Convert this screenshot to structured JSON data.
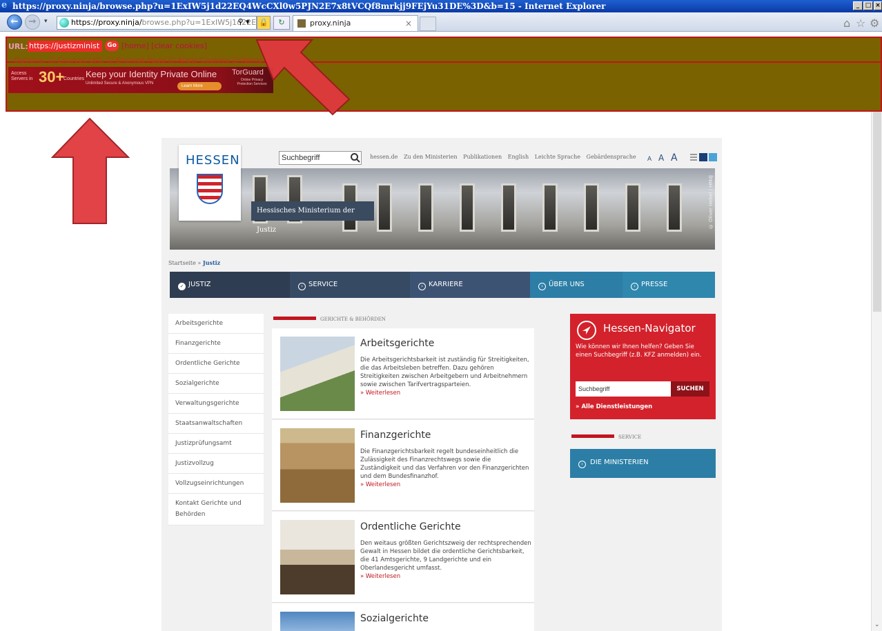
{
  "browser": {
    "title": "https://proxy.ninja/browse.php?u=1ExIW5j1d22EQ4WcCXl0w5PJN2E7x8tVCQf8mrkjj9FEjYu31DE%3D&b=15 - Internet Explorer",
    "address_main": "https://proxy.ninja/",
    "address_dim": "browse.php?u=1ExIW5j1d22EQ4",
    "tab_label": "proxy.ninja",
    "tab_close": "×"
  },
  "proxy": {
    "url_label": "URL:",
    "url_value": "https://justizminist",
    "go_label": "Go",
    "links": "[home] [clear cookies]",
    "options": "Options: ☑ Encrypt URL ☑ Encrypt Page ☑ Allow Cookies ☑ Remove S"
  },
  "ad": {
    "access": "Access Servers in",
    "count": "30+",
    "countries": "Countries",
    "slogan": "Keep your Identity Private Online",
    "sub": "Unlimited Secure & Anonymous VPN",
    "learn": "Learn More",
    "brand": "TorGuard",
    "brand_sub": "Online Privacy Protection Services"
  },
  "site": {
    "logo_text": "HESSEN",
    "search_placeholder": "Suchbegriff",
    "top_links": [
      "hessen.de",
      "Zu den Ministerien",
      "Publikationen",
      "English",
      "Leichte Sprache",
      "Gebärdensprache"
    ],
    "font_sizes": [
      "A",
      "A",
      "A"
    ],
    "banner_credit": "© Oliver Hebel / HMdJ",
    "ministry": "Hessisches Ministerium der Justiz",
    "breadcrumb_home": "Startseite »",
    "breadcrumb_current": "Justiz",
    "nav": [
      {
        "label": "JUSTIZ",
        "color": "#2f3d52"
      },
      {
        "label": "SERVICE",
        "color": "#364a64"
      },
      {
        "label": "KARRIERE",
        "color": "#3d5373"
      },
      {
        "label": "ÜBER UNS",
        "color": "#2c7ea6"
      },
      {
        "label": "PRESSE",
        "color": "#2f87ad"
      }
    ],
    "left_nav": [
      "Arbeitsgerichte",
      "Finanzgerichte",
      "Ordentliche Gerichte",
      "Sozialgerichte",
      "Verwaltungsgerichte",
      "Staatsanwaltschaften",
      "Justizprüfungsamt",
      "Justizvollzug",
      "Vollzugseinrichtungen",
      "Kontakt Gerichte und Behörden"
    ],
    "section_head": "GERICHTE & BEHÖRDEN",
    "articles": [
      {
        "title": "Arbeitsgerichte",
        "text": "Die Arbeitsgerichtsbarkeit ist zuständig für Streitigkeiten, die das Arbeitsleben betreffen. Dazu gehören Streitigkeiten zwischen Arbeitgebern und Arbeitnehmern sowie zwischen Tarifvertragsparteien.",
        "more": "» Weiterlesen"
      },
      {
        "title": "Finanzgerichte",
        "text": "Die Finanzgerichtsbarkeit regelt bundeseinheitlich die Zulässigkeit des Finanzrechtswegs sowie die Zuständigkeit und das Verfahren vor den Finanzgerichten und dem Bundesfinanzhof.",
        "more": "» Weiterlesen"
      },
      {
        "title": "Ordentliche Gerichte",
        "text": "Den weitaus größten Gerichtszweig der rechtsprechenden Gewalt in Hessen bildet die ordentliche Gerichtsbarkeit, die 41 Amtsgerichte, 9 Landgerichte und ein Oberlandesgericht umfasst.",
        "more": "» Weiterlesen"
      },
      {
        "title": "Sozialgerichte",
        "text": "",
        "more": ""
      }
    ],
    "navigator": {
      "title": "Hessen-Navigator",
      "question": "Wie können wir Ihnen helfen? Geben Sie einen Suchbegriff (z.B. KFZ anmelden) ein.",
      "input": "Suchbegriff",
      "button": "SUCHEN",
      "all": "» Alle Dienstleistungen"
    },
    "service_head": "SERVICE",
    "ministries_button": "DIE MINISTERIEN"
  }
}
